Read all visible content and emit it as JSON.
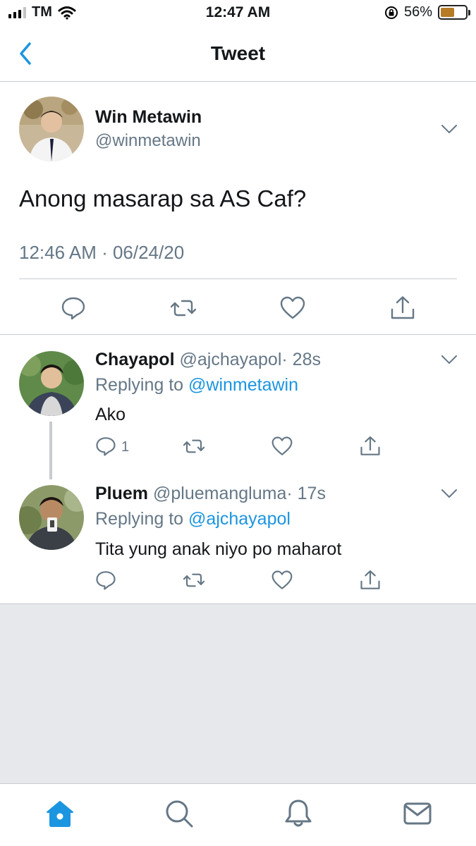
{
  "status_bar": {
    "carrier": "TM",
    "time": "12:47 AM",
    "battery_percent": "56%",
    "battery_level": 0.56,
    "battery_color": "#b77a25"
  },
  "nav": {
    "title": "Tweet",
    "back_icon": "chevron-left-icon"
  },
  "main_tweet": {
    "display_name": "Win Metawin",
    "handle": "@winmetawin",
    "text": "Anong masarap sa AS Caf?",
    "timestamp": "12:46 AM · 06/24/20"
  },
  "replies": [
    {
      "display_name": "Chayapol",
      "handle": "@ajchayapol",
      "time": "· 28s",
      "replying_prefix": "Replying to ",
      "replying_to": "@winmetawin",
      "text": "Ako",
      "reply_count": "1"
    },
    {
      "display_name": "Pluem",
      "handle": "@pluemangluma",
      "time": "· 17s",
      "replying_prefix": "Replying to ",
      "replying_to": "@ajchayapol",
      "text": "Tita yung anak niyo po maharot",
      "reply_count": ""
    }
  ],
  "tab_bar": {
    "tabs": [
      "home-icon",
      "search-icon",
      "notifications-icon",
      "messages-icon"
    ],
    "active": "home-icon"
  },
  "colors": {
    "accent": "#1b95e0",
    "secondary_text": "#657786",
    "divider": "#c8ccd0",
    "empty_background": "#e6e8eb"
  }
}
